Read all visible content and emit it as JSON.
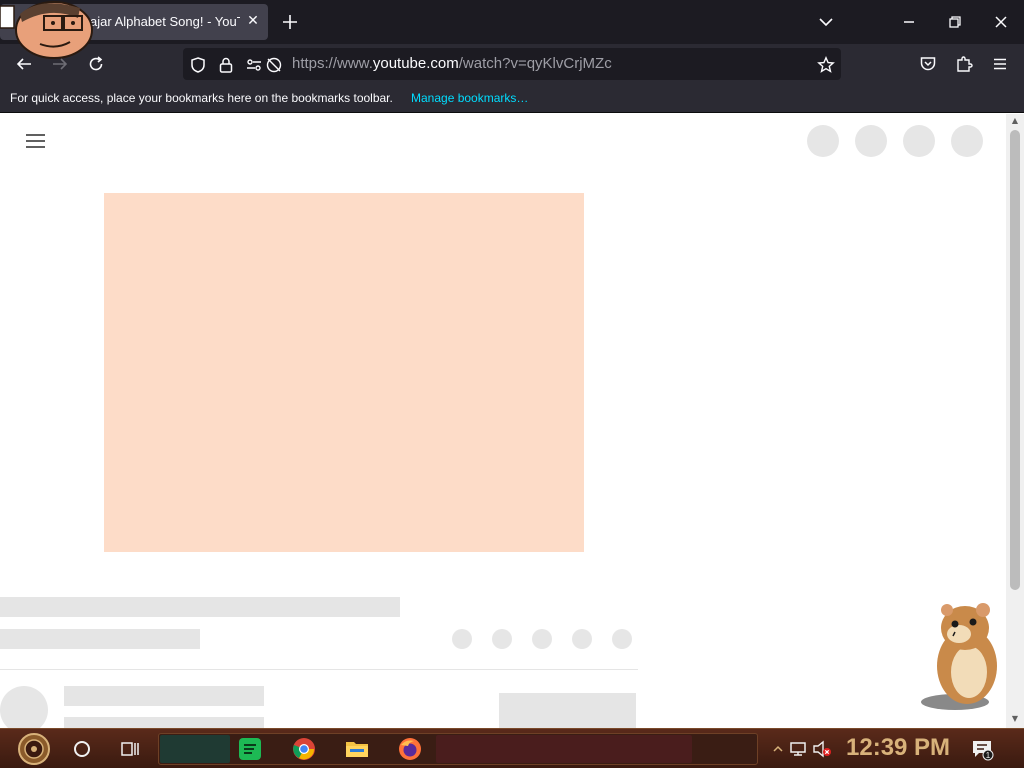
{
  "browser": {
    "tab": {
      "title": "ajar Alphabet Song! - YouTube"
    },
    "url": {
      "prefix": "https://www.",
      "host": "youtube.com",
      "path": "/watch?v=qyKlvCrjMZc"
    },
    "bookmarks_bar": {
      "message": "For quick access, place your bookmarks here on the bookmarks toolbar.",
      "link": "Manage bookmarks…"
    }
  },
  "page": {
    "state": "loading-skeleton",
    "player_color": "#fddcc8",
    "skeleton_color": "#e5e5e5"
  },
  "taskbar": {
    "clock": "12:39 PM",
    "pinned": [
      "search-circle-icon",
      "task-view-icon",
      "spotify-icon",
      "chrome-icon",
      "file-explorer-icon",
      "firefox-icon"
    ],
    "notification_count": "1"
  },
  "colors": {
    "tabstrip": "#1c1b22",
    "toolbar": "#2b2a33",
    "link": "#00ddff",
    "clock": "#d8b27a"
  }
}
